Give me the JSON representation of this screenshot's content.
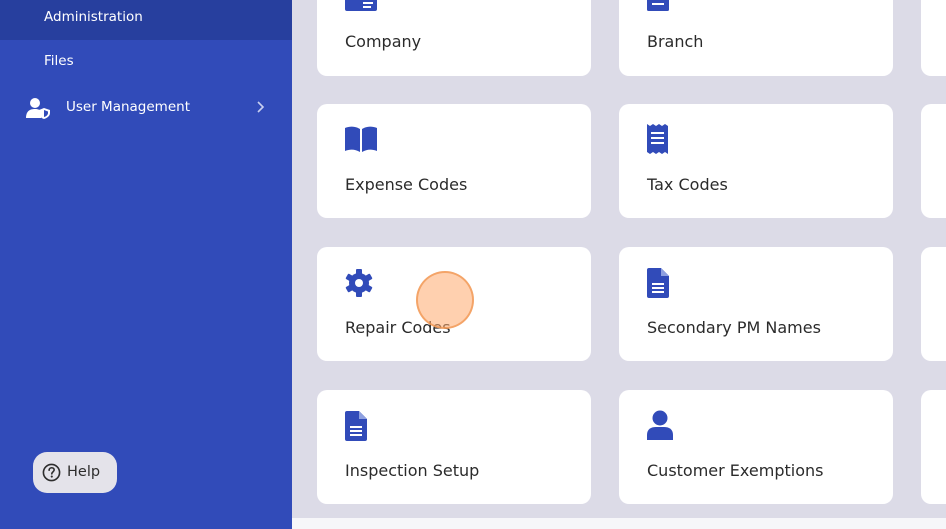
{
  "sidebar": {
    "items": [
      {
        "label": "Administration",
        "active": true
      },
      {
        "label": "Files",
        "active": false
      },
      {
        "label": "User Management",
        "icon": "user-shield-icon",
        "has_submenu": true
      }
    ],
    "help_label": "Help",
    "colors": {
      "background": "#314bb9",
      "active": "#273f9e"
    }
  },
  "cards": [
    {
      "label": "Company",
      "icon": "id-card-icon"
    },
    {
      "label": "Branch",
      "icon": "document-icon"
    },
    {
      "label": "Expense Codes",
      "icon": "book-open-icon"
    },
    {
      "label": "Tax Codes",
      "icon": "receipt-icon"
    },
    {
      "label": "Repair Codes",
      "icon": "gear-icon"
    },
    {
      "label": "Secondary PM Names",
      "icon": "document-icon"
    },
    {
      "label": "Inspection Setup",
      "icon": "document-icon"
    },
    {
      "label": "Customer Exemptions",
      "icon": "user-icon"
    }
  ],
  "theme": {
    "accent": "#314bb9",
    "page_bg": "#dcdbe7",
    "card_bg": "#ffffff"
  }
}
